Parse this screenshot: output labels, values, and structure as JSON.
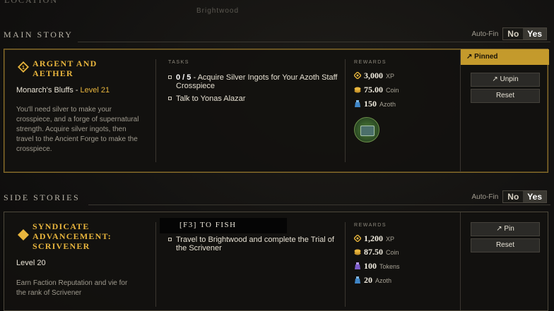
{
  "location": {
    "label": "LOCATION",
    "value": "Brightwood"
  },
  "main_story": {
    "title": "MAIN STORY",
    "autofin": {
      "label": "Auto-Fin",
      "no": "No",
      "yes": "Yes",
      "selected": "Yes"
    },
    "quest": {
      "title": "ARGENT AND AETHER",
      "region": "Monarch's Bluffs",
      "level": "Level 21",
      "description": "You'll need silver to make your crosspiece, and a forge of supernatural strength. Acquire silver ingots, then travel to the Ancient Forge to make the crosspiece.",
      "tasks_label": "TASKS",
      "tasks": [
        {
          "progress": "0 / 5",
          "text": " - Acquire Silver Ingots for Your Azoth Staff Crosspiece"
        },
        {
          "progress": "",
          "text": "Talk to Yonas Alazar"
        }
      ],
      "rewards_label": "REWARDS",
      "rewards": [
        {
          "value": "3,000",
          "unit": "XP",
          "icon": "xp-icon"
        },
        {
          "value": "75.00",
          "unit": "Coin",
          "icon": "coin-icon"
        },
        {
          "value": "150",
          "unit": "Azoth",
          "icon": "azoth-icon"
        }
      ],
      "pinned_label": "Pinned",
      "unpin_label": "Unpin",
      "reset_label": "Reset"
    }
  },
  "side_stories": {
    "title": "SIDE STORIES",
    "autofin": {
      "label": "Auto-Fin",
      "no": "No",
      "yes": "Yes",
      "selected": "Yes"
    },
    "quest": {
      "title": "SYNDICATE ADVANCEMENT: SCRIVENER",
      "level": "Level 20",
      "description": "Earn Faction Reputation and vie for the rank of Scrivener",
      "tasks": [
        {
          "progress": "",
          "text": "Travel to Brightwood and complete the Trial of the Scrivener"
        }
      ],
      "rewards_label": "REWARDS",
      "rewards": [
        {
          "value": "1,200",
          "unit": "XP",
          "icon": "xp-icon"
        },
        {
          "value": "87.50",
          "unit": "Coin",
          "icon": "coin-icon"
        },
        {
          "value": "100",
          "unit": "Tokens",
          "icon": "token-icon"
        },
        {
          "value": "20",
          "unit": "Azoth",
          "icon": "azoth-icon"
        }
      ],
      "pin_label": "Pin",
      "reset_label": "Reset"
    }
  },
  "prompt": {
    "key": "[F3]",
    "text": " TO FISH"
  },
  "colors": {
    "accent_gold": "#e8b53d",
    "pinned_bg": "#c49a2c"
  }
}
